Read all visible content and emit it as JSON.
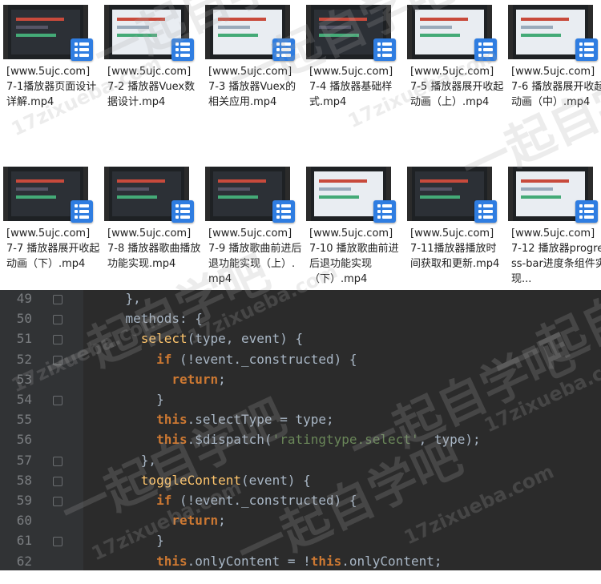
{
  "files": [
    {
      "prefix": "[www.5ujc.com]",
      "name": "7-1播放器页面设计详解.mp4",
      "theme": "dark"
    },
    {
      "prefix": "[www.5ujc.com]",
      "name": "7-2 播放器Vuex数据设计.mp4",
      "theme": "light"
    },
    {
      "prefix": "[www.5ujc.com]",
      "name": "7-3 播放器Vuex的相关应用.mp4",
      "theme": "light"
    },
    {
      "prefix": "[www.5ujc.com]",
      "name": "7-4 播放器基础样式.mp4",
      "theme": "dark"
    },
    {
      "prefix": "[www.5ujc.com]",
      "name": "7-5 播放器展开收起动画（上）.mp4",
      "theme": "light"
    },
    {
      "prefix": "[www.5ujc.com]",
      "name": "7-6 播放器展开收起动画（中）.mp4",
      "theme": "light"
    },
    {
      "prefix": "[www.5ujc.com]",
      "name": "7-7 播放器展开收起动画（下）.mp4",
      "theme": "dark"
    },
    {
      "prefix": "[www.5ujc.com]",
      "name": "7-8 播放器歌曲播放功能实现.mp4",
      "theme": "dark"
    },
    {
      "prefix": "[www.5ujc.com]",
      "name": "7-9 播放歌曲前进后退功能实现（上）.mp4",
      "theme": "dark"
    },
    {
      "prefix": "[www.5ujc.com]",
      "name": "7-10 播放歌曲前进后退功能实现（下）.mp4",
      "theme": "light"
    },
    {
      "prefix": "[www.5ujc.com]",
      "name": "7-11播放器播放时间获取和更新.mp4",
      "theme": "dark"
    },
    {
      "prefix": "[www.5ujc.com]",
      "name": "7-12 播放器progress-bar进度条组件实现...",
      "theme": "light"
    }
  ],
  "editor": {
    "lines": [
      {
        "no": "49",
        "fold": true,
        "parts": [
          [
            "    },",
            ""
          ]
        ]
      },
      {
        "no": "50",
        "fold": true,
        "parts": [
          [
            "    methods: {",
            ""
          ]
        ]
      },
      {
        "no": "51",
        "fold": true,
        "parts": [
          [
            "      ",
            ""
          ],
          [
            "select",
            "fn"
          ],
          [
            "(type, event) {",
            ""
          ]
        ]
      },
      {
        "no": "52",
        "fold": true,
        "parts": [
          [
            "        ",
            ""
          ],
          [
            "if",
            "kw"
          ],
          [
            " (!event._constructed) {",
            ""
          ]
        ]
      },
      {
        "no": "53",
        "fold": false,
        "parts": [
          [
            "          ",
            ""
          ],
          [
            "return",
            "kw"
          ],
          [
            ";",
            ""
          ]
        ]
      },
      {
        "no": "54",
        "fold": true,
        "parts": [
          [
            "        }",
            ""
          ]
        ]
      },
      {
        "no": "55",
        "fold": false,
        "parts": [
          [
            "        ",
            ""
          ],
          [
            "this",
            "kw"
          ],
          [
            ".selectType = type;",
            ""
          ]
        ]
      },
      {
        "no": "56",
        "fold": false,
        "parts": [
          [
            "        ",
            ""
          ],
          [
            "this",
            "kw"
          ],
          [
            ".$dispatch(",
            ""
          ],
          [
            "'ratingtype.select'",
            "str"
          ],
          [
            ", type);",
            ""
          ]
        ]
      },
      {
        "no": "57",
        "fold": true,
        "parts": [
          [
            "      },",
            ""
          ]
        ]
      },
      {
        "no": "58",
        "fold": true,
        "parts": [
          [
            "      ",
            ""
          ],
          [
            "toggleContent",
            "fn"
          ],
          [
            "(event) {",
            ""
          ]
        ]
      },
      {
        "no": "59",
        "fold": true,
        "parts": [
          [
            "        ",
            ""
          ],
          [
            "if",
            "kw"
          ],
          [
            " (!event._constructed) {",
            ""
          ]
        ]
      },
      {
        "no": "60",
        "fold": false,
        "parts": [
          [
            "          ",
            ""
          ],
          [
            "return",
            "kw"
          ],
          [
            ";",
            ""
          ]
        ]
      },
      {
        "no": "61",
        "fold": true,
        "parts": [
          [
            "        }",
            ""
          ]
        ]
      },
      {
        "no": "62",
        "fold": false,
        "parts": [
          [
            "        ",
            ""
          ],
          [
            "this",
            "kw"
          ],
          [
            ".onlyContent = !",
            ""
          ],
          [
            "this",
            "kw"
          ],
          [
            ".onlyContent;",
            ""
          ]
        ]
      }
    ]
  },
  "watermarks": [
    "一起自学吧",
    "17zixueba.com"
  ],
  "colors": {
    "badge": "#2f7de1",
    "editor_bg": "#2b2b2b",
    "keyword": "#cc7832",
    "function": "#ffc66d",
    "string": "#6a8759"
  }
}
